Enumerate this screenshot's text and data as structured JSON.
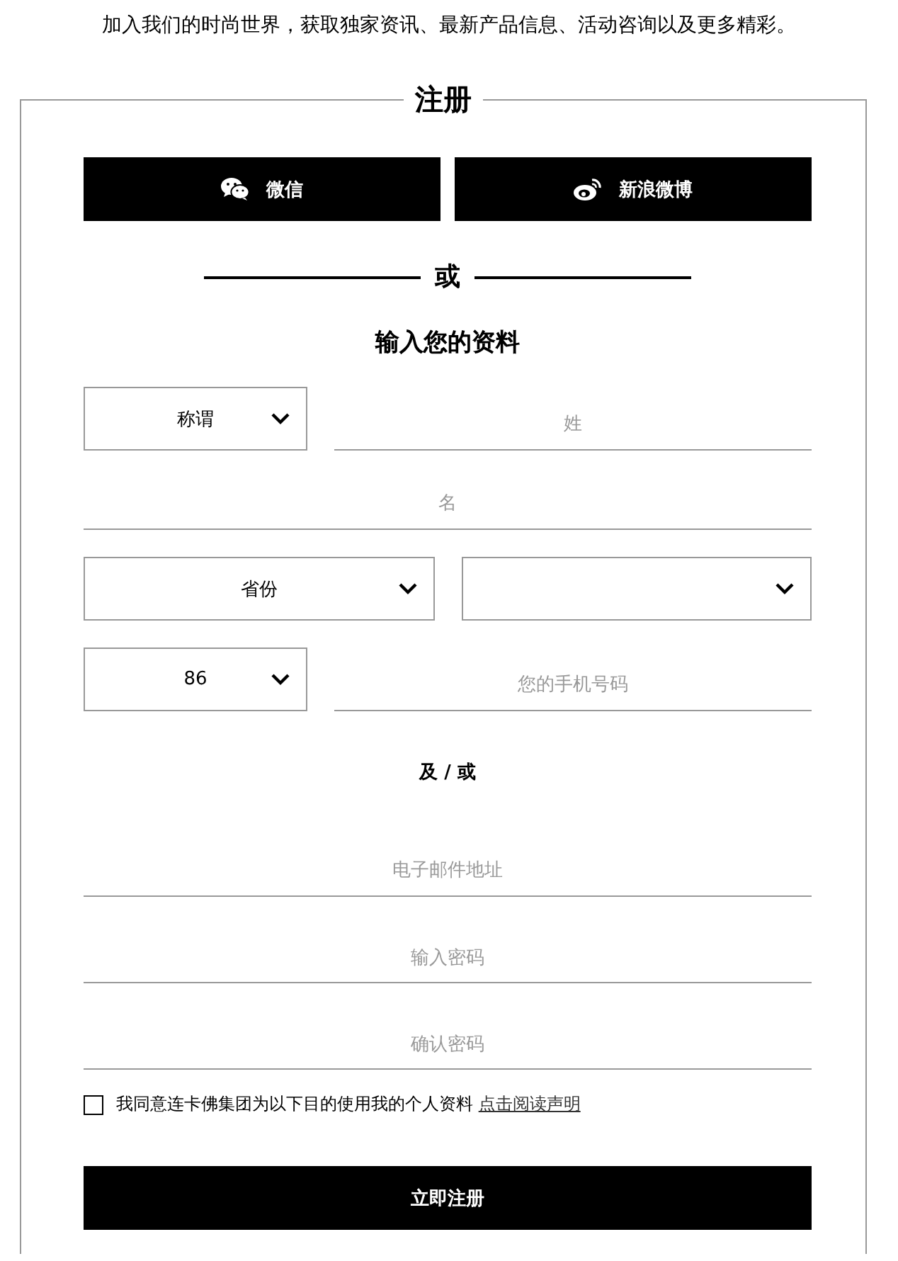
{
  "intro": "加入我们的时尚世界，获取独家资讯、最新产品信息、活动咨询以及更多精彩。",
  "form": {
    "title": "注册",
    "social_buttons": [
      {
        "kind": "wechat",
        "label": "微信"
      },
      {
        "kind": "weibo",
        "label": "新浪微博"
      }
    ],
    "divider_text": "或",
    "section_title": "输入您的资料",
    "rows": [
      [
        {
          "kind": "select",
          "value": "称谓"
        },
        {
          "kind": "input",
          "placeholder": "姓"
        }
      ],
      [
        {
          "kind": "input",
          "placeholder": "名"
        }
      ],
      [
        {
          "kind": "select",
          "value": "省份"
        },
        {
          "kind": "select"
        }
      ],
      [
        {
          "kind": "select",
          "value": "86"
        },
        {
          "kind": "input",
          "placeholder": "您的手机号码"
        }
      ]
    ],
    "and_or": "及 / 或",
    "account_fields": [
      {
        "kind": "input",
        "placeholder": "电子邮件地址"
      },
      {
        "kind": "input",
        "placeholder": "输入密码"
      },
      {
        "kind": "input",
        "placeholder": "确认密码"
      }
    ],
    "consent": {
      "text": "我同意连卡佛集团为以下目的使用我的个人资料",
      "link": "点击阅读声明",
      "checked": false
    },
    "submit": "立即注册"
  }
}
